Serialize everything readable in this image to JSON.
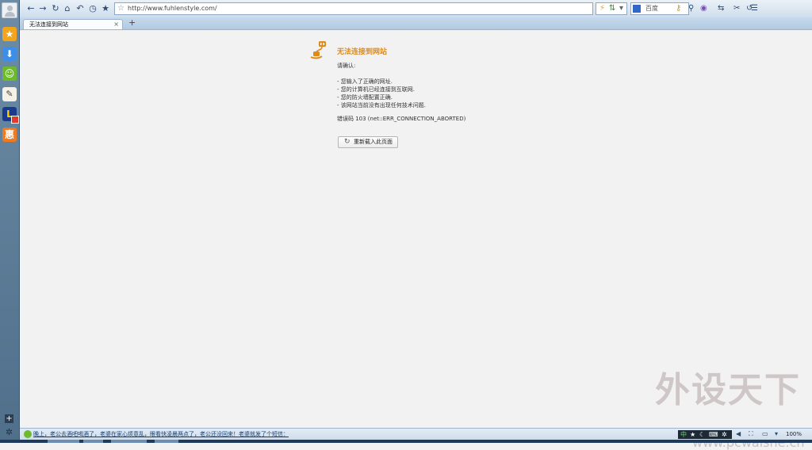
{
  "toolbar": {
    "url": "http://www.fuhlenstyle.com/",
    "search_engine": "百度"
  },
  "tabs": [
    {
      "label": "无法连接到网站"
    }
  ],
  "error": {
    "title": "无法连接到网站",
    "intro": "请确认:",
    "checks": [
      "- 您输入了正确的网址.",
      "- 您的计算机已经连接到互联网.",
      "- 您的防火墙配置正确.",
      "- 该网站当前没有出现任何技术问题."
    ],
    "code": "错误码 103 (net::ERR_CONNECTION_ABORTED)",
    "reload_label": "重新载入此页面"
  },
  "statusbar": {
    "news": "晚上，老公去酒吧喝酒了，老婆在家心烦意乱，眼看快凌晨两点了，老公还没回来！老婆就发了个短信：",
    "ime": "中",
    "zoom": "100%"
  },
  "watermark": {
    "brand": "外设天下",
    "url": "www.pcwaishe.cn"
  },
  "colors": {
    "accent": "#e08a17",
    "toolbar": "#dbe7f2",
    "page_bg": "#f2f2f2"
  },
  "icons": [
    "back-icon",
    "forward-icon",
    "refresh-icon",
    "home-icon",
    "undo-icon",
    "history-icon",
    "favorite-icon",
    "plug-icon",
    "reload-icon"
  ]
}
